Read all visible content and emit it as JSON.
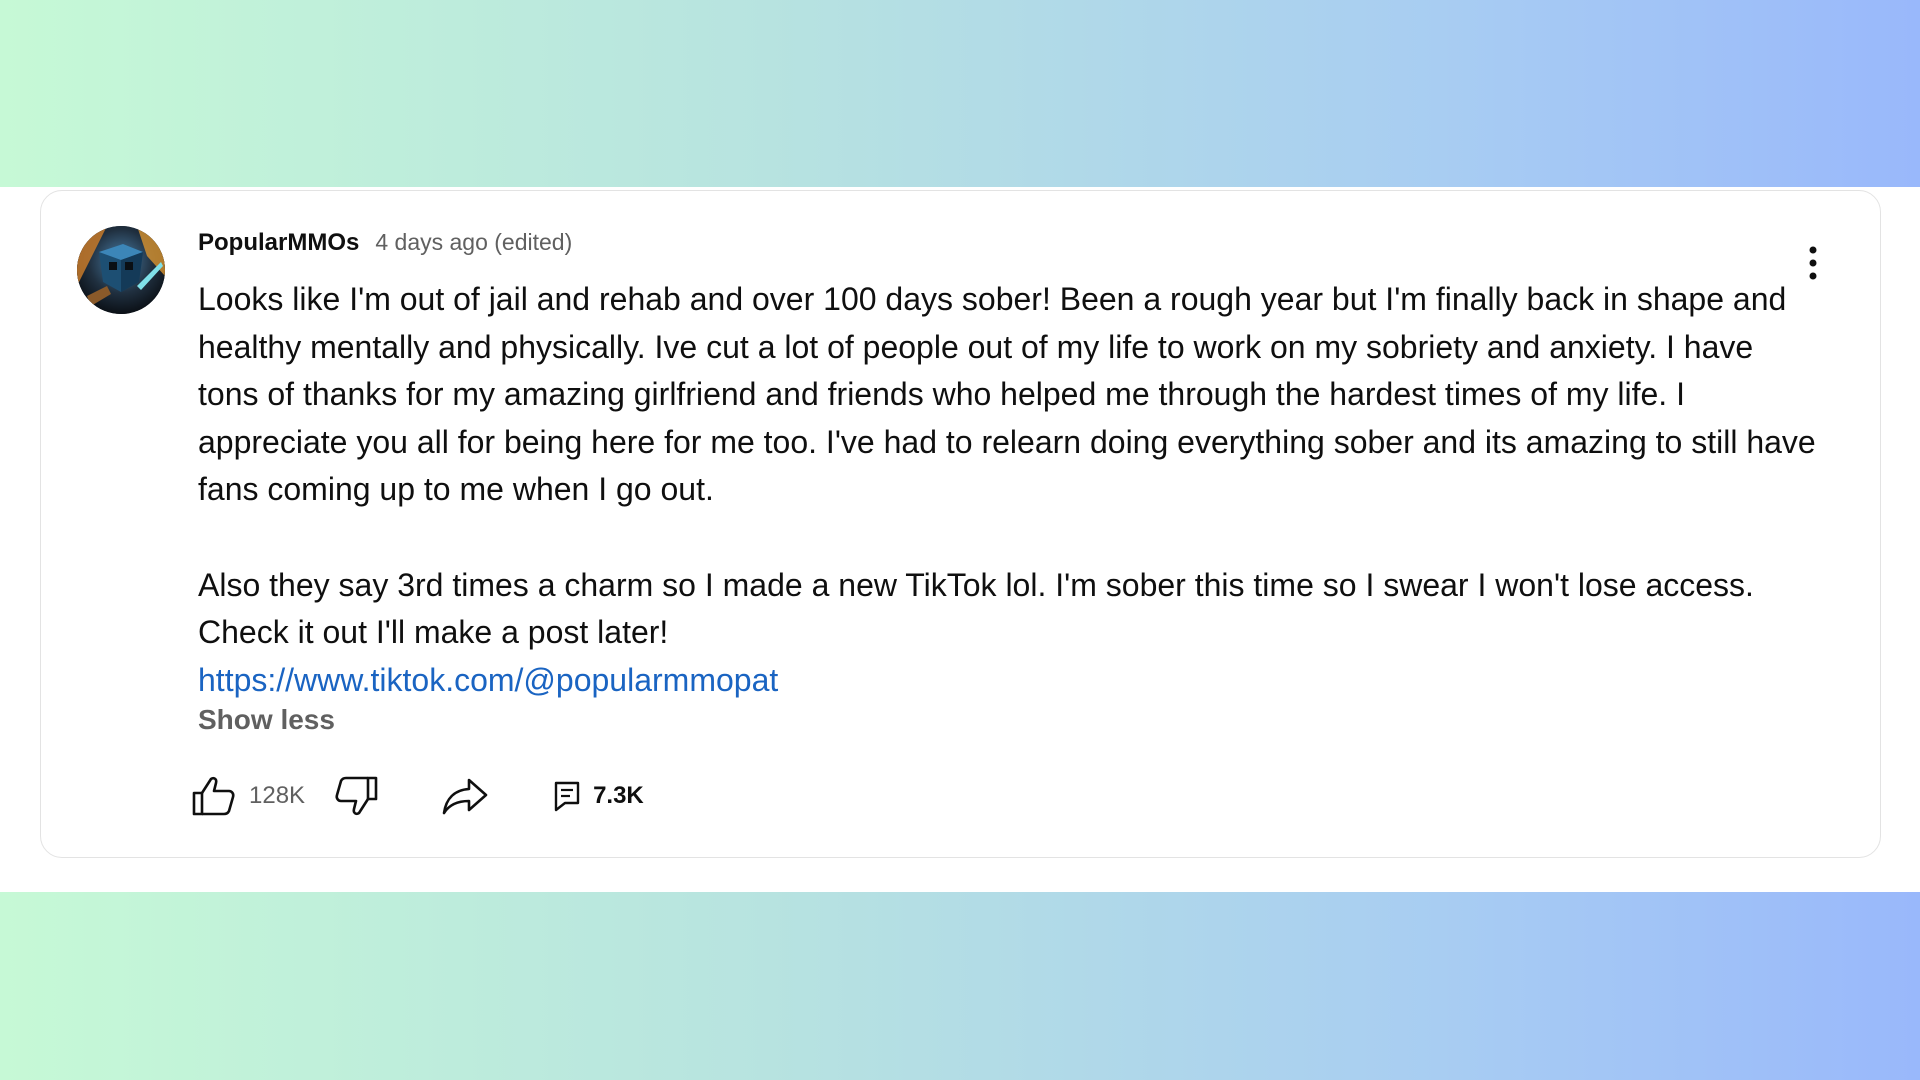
{
  "comment": {
    "author": "PopularMMOs",
    "time": "4 days ago (edited)",
    "paragraph1": "Looks like I'm out of jail and rehab and over 100 days sober! Been a rough year but I'm finally back in shape and healthy mentally and physically. Ive cut a lot of people out of my life to work on my sobriety and anxiety. I have tons of thanks for my amazing girlfriend and friends who helped me through the hardest times of my life. I appreciate you all for being here for me too. I've had to relearn doing everything sober and its amazing to still have fans coming up to me when I go out.",
    "paragraph2": "Also they say 3rd times a charm so I made a new TikTok lol. I'm sober this time so I swear I won't lose access. Check it out I'll make a post later!",
    "link": "https://www.tiktok.com/@popularmmopat",
    "show_less": "Show less",
    "likes": "128K",
    "replies": "7.3K"
  },
  "icons": {
    "avatar": "avatar-image",
    "more": "more-vert-icon",
    "like": "thumbs-up-icon",
    "dislike": "thumbs-down-icon",
    "share": "share-arrow-icon",
    "reply": "comment-icon"
  },
  "colors": {
    "link": "#1a64c2",
    "secondary_text": "#606060",
    "primary_text": "#0f0f0f"
  }
}
